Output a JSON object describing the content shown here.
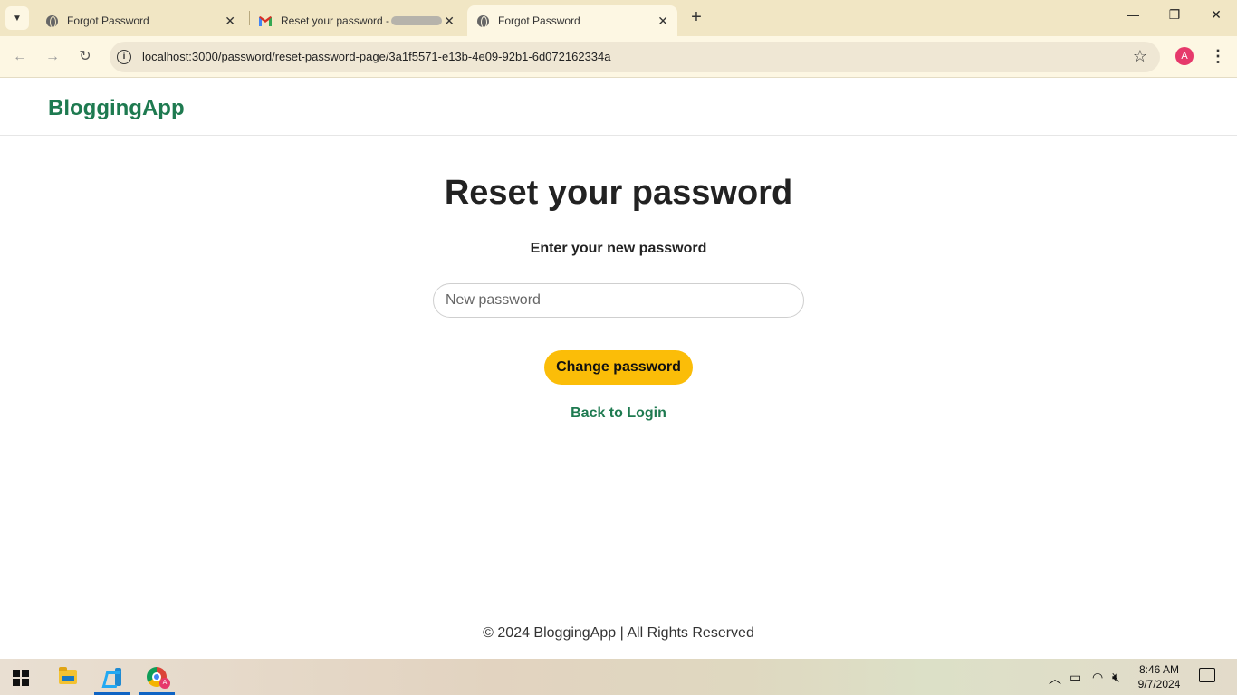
{
  "browser": {
    "tabs": [
      {
        "title": "Forgot Password",
        "icon": "globe-icon",
        "active": false
      },
      {
        "title": "Reset your password -",
        "icon": "gmail-icon",
        "active": false
      },
      {
        "title": "Forgot Password",
        "icon": "globe-icon",
        "active": true
      }
    ],
    "new_tab": "+",
    "tab_close": "✕",
    "url": "localhost:3000/password/reset-password-page/3a1f5571-e13b-4e09-92b1-6d072162334a",
    "profile_initial": "A",
    "window_controls": {
      "minimize": "—",
      "restore": "❐",
      "close": "✕"
    }
  },
  "site": {
    "brand": "BloggingApp"
  },
  "form": {
    "title": "Reset your password",
    "subtitle": "Enter your new password",
    "password_placeholder": "New password",
    "submit_label": "Change password",
    "back_label": "Back to Login"
  },
  "footer": {
    "text": "© 2024 BloggingApp | All Rights Reserved"
  },
  "taskbar": {
    "time": "8:46 AM",
    "date": "9/7/2024",
    "chrome_badge": "A"
  },
  "colors": {
    "brand_green": "#1e7a50",
    "button_yellow": "#fbbd08",
    "tabbar_bg": "#f1e6c4"
  }
}
